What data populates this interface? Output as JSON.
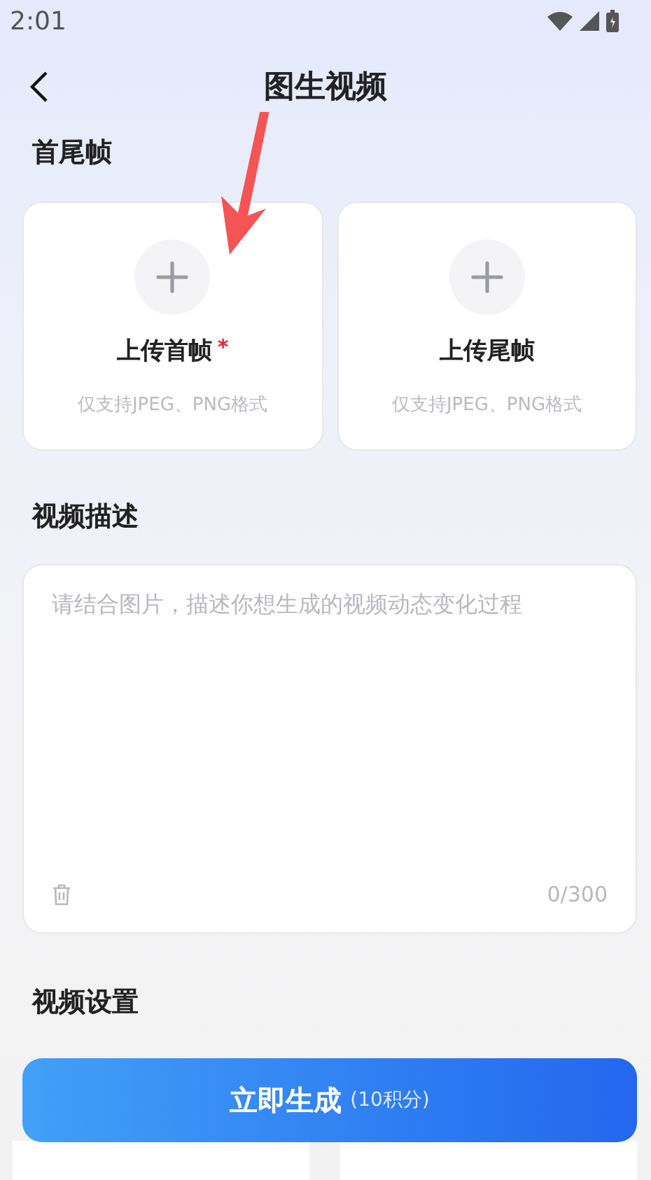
{
  "status_bar": {
    "time": "2:01"
  },
  "header": {
    "title": "图生视频"
  },
  "frames": {
    "title": "首尾帧",
    "cards": [
      {
        "label": "上传首帧",
        "required_mark": "*",
        "hint": "仅支持JPEG、PNG格式"
      },
      {
        "label": "上传尾帧",
        "hint": "仅支持JPEG、PNG格式"
      }
    ]
  },
  "description": {
    "title": "视频描述",
    "placeholder": "请结合图片，描述你想生成的视频动态变化过程",
    "counter": "0/300"
  },
  "settings": {
    "title": "视频设置"
  },
  "generate_button": {
    "label": "立即生成",
    "cost": "(10积分)"
  }
}
